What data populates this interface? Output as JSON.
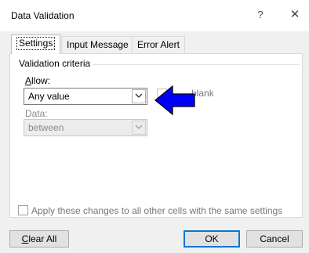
{
  "window": {
    "title": "Data Validation",
    "help_glyph": "?",
    "close_glyph": "✕"
  },
  "tabs": [
    {
      "label": "Settings",
      "active": true
    },
    {
      "label": "Input Message",
      "active": false
    },
    {
      "label": "Error Alert",
      "active": false
    }
  ],
  "criteria": {
    "group_title": "Validation criteria",
    "allow_label_accel": "A",
    "allow_label_rest": "llow:",
    "allow_value": "Any value",
    "ignore_blank_label": "blank",
    "data_label": "Data:",
    "data_value": "between"
  },
  "apply_all_label": "Apply these changes to all other cells with the same settings",
  "buttons": {
    "clear_all_accel": "C",
    "clear_all_rest": "lear All",
    "ok": "OK",
    "cancel": "Cancel"
  },
  "colors": {
    "annotation_arrow": "#0000ff"
  }
}
